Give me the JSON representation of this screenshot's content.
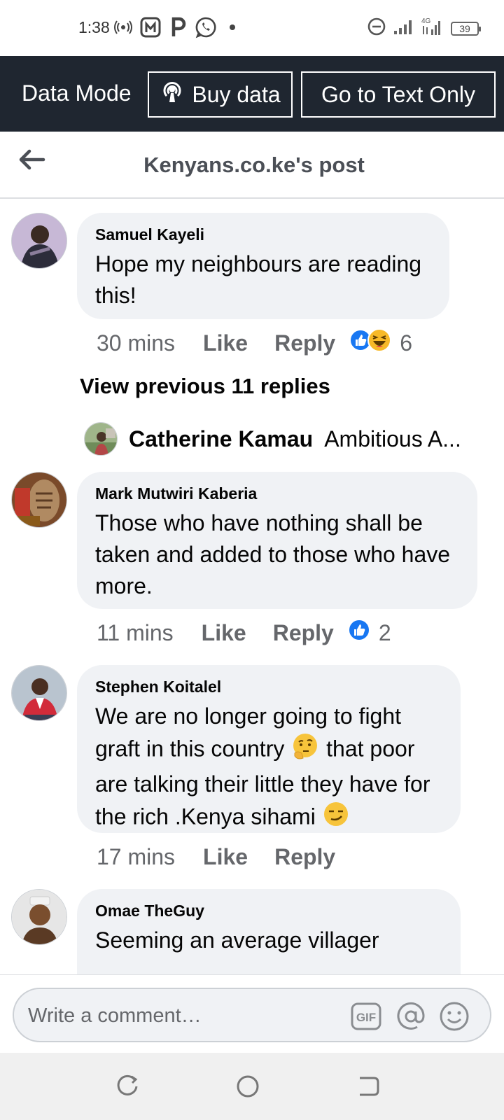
{
  "status_bar": {
    "time": "1:38",
    "battery": "39"
  },
  "data_bar": {
    "mode_label": "Data Mode",
    "buy_data_label": "Buy data",
    "text_only_label": "Go to Text Only"
  },
  "header": {
    "title": "Kenyans.co.ke's post"
  },
  "comments": [
    {
      "author": "Samuel Kayeli",
      "text": "Hope my neighbours are reading this!",
      "time": "30 mins",
      "like": "Like",
      "reply": "Reply",
      "reactions": [
        "like",
        "haha"
      ],
      "reaction_count": "6"
    },
    {
      "author": "Mark Mutwiri Kaberia",
      "text": "Those who have nothing shall be taken and added to those who have more.",
      "time": "11 mins",
      "like": "Like",
      "reply": "Reply",
      "reactions": [
        "like"
      ],
      "reaction_count": "2"
    },
    {
      "author": "Stephen Koitalel",
      "text_parts": [
        "We are no longer going to fight graft in this country ",
        " that poor are talking their little they have for the rich .Kenya sihami "
      ],
      "emojis": [
        "thinking-face",
        "smirking-face"
      ],
      "time": "17 mins",
      "like": "Like",
      "reply": "Reply"
    },
    {
      "author": "Omae TheGuy",
      "text": "Seeming an average villager"
    }
  ],
  "thread": {
    "view_previous": "View previous 11 replies",
    "preview_name": "Catherine Kamau",
    "preview_snippet": "Ambitious A..."
  },
  "composer": {
    "placeholder": "Write a comment…",
    "gif_label": "GIF"
  },
  "icons": {
    "back": "arrow-left-icon",
    "buy_data": "podcast-broadcast-icon",
    "gif": "gif-icon",
    "mention": "at-sign-icon",
    "emoji": "smiley-icon"
  },
  "colors": {
    "data_bar_bg": "#1f2630",
    "bubble_bg": "#f0f2f5",
    "meta_text": "#65676b",
    "like_blue": "#1877f2"
  }
}
